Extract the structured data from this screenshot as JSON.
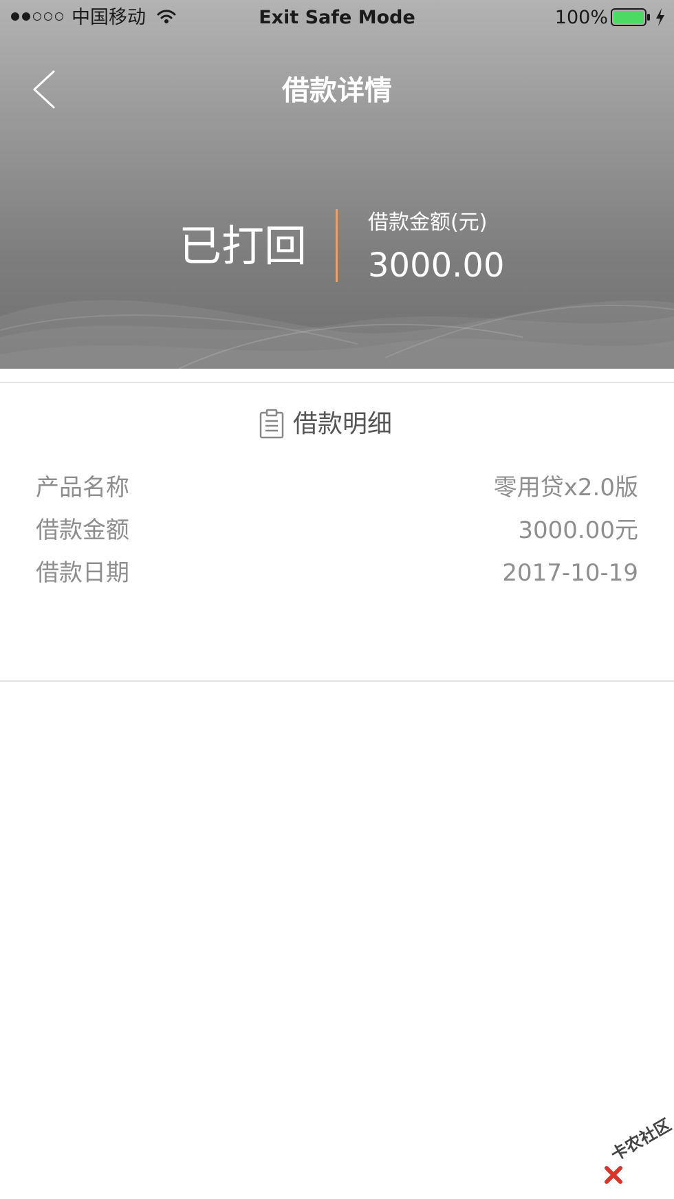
{
  "status_bar": {
    "signal": "●●○○○",
    "carrier": "中国移动",
    "title": "Exit Safe Mode",
    "battery_percent": "100%",
    "battery_color": "#4cd964"
  },
  "nav": {
    "title": "借款详情"
  },
  "summary": {
    "status": "已打回",
    "amount_label": "借款金额(元)",
    "amount_value": "3000.00",
    "accent_color": "#e8a06c"
  },
  "details": {
    "section_title": "借款明细",
    "rows": [
      {
        "label": "产品名称",
        "value": "零用贷x2.0版"
      },
      {
        "label": "借款金额",
        "value": "3000.00元"
      },
      {
        "label": "借款日期",
        "value": "2017-10-19"
      }
    ]
  },
  "watermark": {
    "text": "卡农社区"
  }
}
